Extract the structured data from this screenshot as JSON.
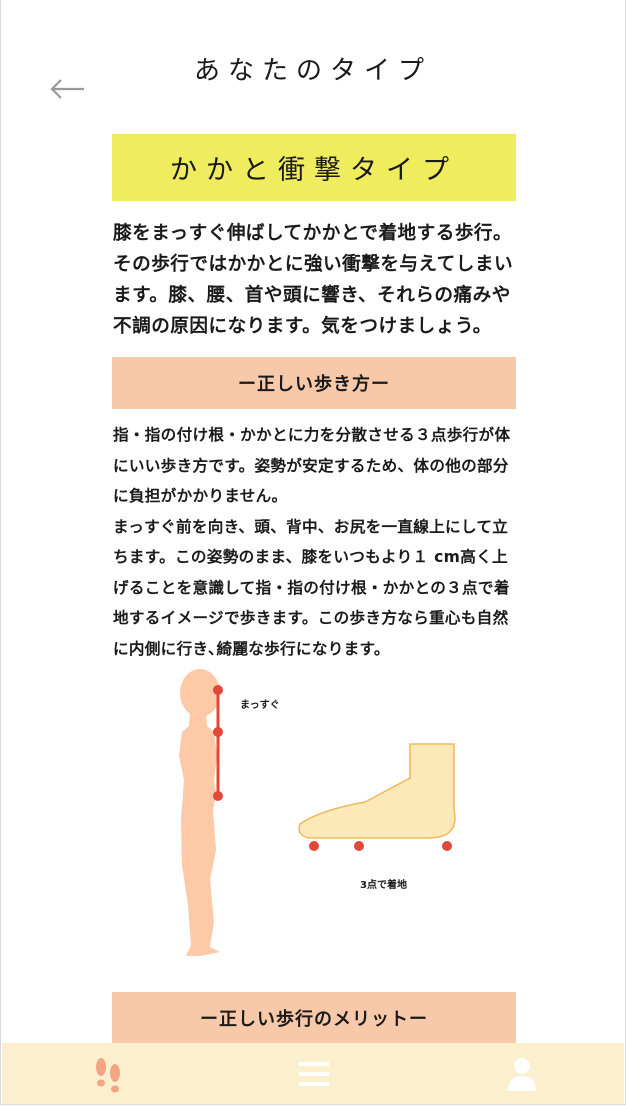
{
  "header": {
    "title": "あなたのタイプ",
    "back_icon": "arrow-left-icon"
  },
  "type_result": {
    "name": "かかと衝撃タイプ",
    "color": "#efed5e",
    "description": "膝をまっすぐ伸ばしてかかとで着地する歩行。その歩行ではかかとに強い衝撃を与えてしまいます。膝、腰、首や頭に響き、それらの痛みや不調の原因になります。気をつけましょう。"
  },
  "correct_walking": {
    "heading": "ー正しい歩き方ー",
    "color": "#f8c9a9",
    "paragraph_1": "指・指の付け根・かかとに力を分散させる３点歩行が体にいい歩き方です。姿勢が安定するため、体の他の部分に負担がかかりません。",
    "paragraph_2": "まっすぐ前を向き、頭、背中、お尻を一直線上にして立ちます。この姿勢のまま、膝をいつもより１ cm高く上げることを意識して指・指の付け根・かかとの３点で着地するイメージで歩きます。この歩き方なら重心も自然に内側に行き､綺麗な歩行になります。",
    "illustration": {
      "posture_label": "まっすぐ",
      "foot_label": "3点で着地"
    }
  },
  "merit_section": {
    "heading": "ー正しい歩行のメリットー"
  },
  "bottom_nav": {
    "background": "#fcefcd",
    "items": [
      {
        "icon": "footprints-icon",
        "color": "#f4a582"
      },
      {
        "icon": "menu-icon",
        "color": "#ffffff"
      },
      {
        "icon": "user-icon",
        "color": "#ffffff"
      }
    ]
  }
}
